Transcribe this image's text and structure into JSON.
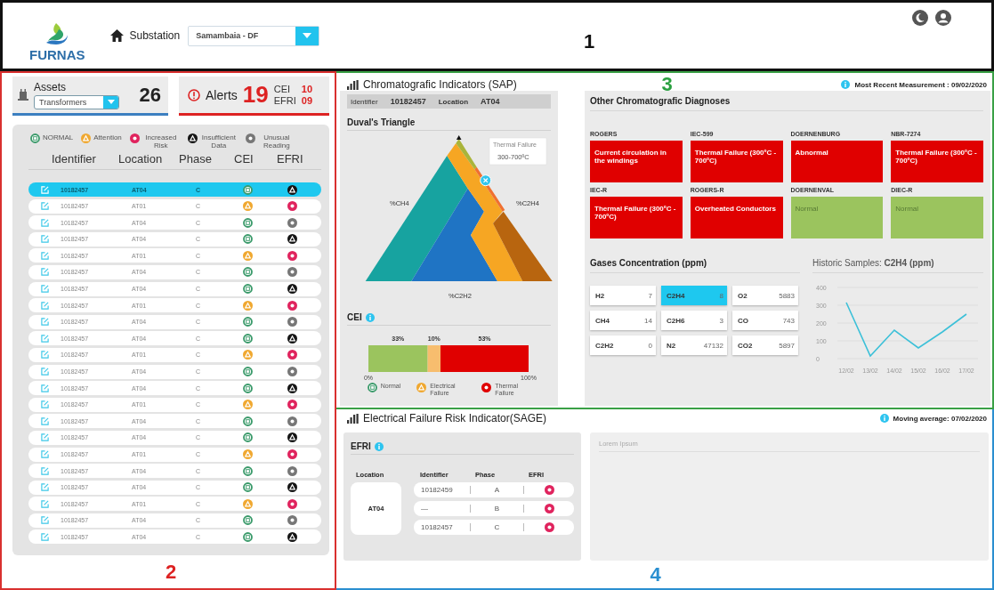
{
  "header": {
    "logo_text": "FURNAS",
    "substation_label": "Substation",
    "substation": "Samambaia - DF",
    "section_number": "1"
  },
  "assets": {
    "label": "Assets",
    "type": "Transformers",
    "count": "26"
  },
  "alerts": {
    "label": "Alerts",
    "count": "19",
    "items": [
      {
        "label": "CEI",
        "count": "10"
      },
      {
        "label": "EFRI",
        "count": "09"
      }
    ]
  },
  "legend": [
    {
      "label": "NORMAL",
      "kind": "normal"
    },
    {
      "label": "Attention",
      "kind": "attention"
    },
    {
      "label": "Increased Risk",
      "kind": "increased_risk"
    },
    {
      "label": "Insufficient Data",
      "kind": "insufficient_data"
    },
    {
      "label": "Unusual Reading",
      "kind": "unusual_reading"
    }
  ],
  "asset_table": {
    "columns": [
      "Identifier",
      "Location",
      "Phase",
      "CEI",
      "EFRI"
    ],
    "rows": [
      {
        "identifier": "10182457",
        "location": "AT04",
        "phase": "C",
        "cei": {
          "kind": "normal"
        },
        "efri": {
          "kind": "insufficient_data"
        },
        "selected": true
      },
      {
        "identifier": "10182457",
        "location": "AT01",
        "phase": "C",
        "cei": {
          "kind": "attention"
        },
        "efri": {
          "kind": "increased_risk"
        },
        "selected": false
      },
      {
        "identifier": "10182457",
        "location": "AT04",
        "phase": "C",
        "cei": {
          "kind": "normal"
        },
        "efri": {
          "kind": "unusual_reading"
        },
        "selected": false
      },
      {
        "identifier": "10182457",
        "location": "AT04",
        "phase": "C",
        "cei": {
          "kind": "normal"
        },
        "efri": {
          "kind": "insufficient_data"
        },
        "selected": false
      },
      {
        "identifier": "10182457",
        "location": "AT01",
        "phase": "C",
        "cei": {
          "kind": "attention"
        },
        "efri": {
          "kind": "increased_risk"
        },
        "selected": false
      },
      {
        "identifier": "10182457",
        "location": "AT04",
        "phase": "C",
        "cei": {
          "kind": "normal"
        },
        "efri": {
          "kind": "unusual_reading"
        },
        "selected": false
      },
      {
        "identifier": "10182457",
        "location": "AT04",
        "phase": "C",
        "cei": {
          "kind": "normal"
        },
        "efri": {
          "kind": "insufficient_data"
        },
        "selected": false
      },
      {
        "identifier": "10182457",
        "location": "AT01",
        "phase": "C",
        "cei": {
          "kind": "attention"
        },
        "efri": {
          "kind": "increased_risk"
        },
        "selected": false
      },
      {
        "identifier": "10182457",
        "location": "AT04",
        "phase": "C",
        "cei": {
          "kind": "normal"
        },
        "efri": {
          "kind": "unusual_reading"
        },
        "selected": false
      },
      {
        "identifier": "10182457",
        "location": "AT04",
        "phase": "C",
        "cei": {
          "kind": "normal"
        },
        "efri": {
          "kind": "insufficient_data"
        },
        "selected": false
      },
      {
        "identifier": "10182457",
        "location": "AT01",
        "phase": "C",
        "cei": {
          "kind": "attention"
        },
        "efri": {
          "kind": "increased_risk"
        },
        "selected": false
      },
      {
        "identifier": "10182457",
        "location": "AT04",
        "phase": "C",
        "cei": {
          "kind": "normal"
        },
        "efri": {
          "kind": "unusual_reading"
        },
        "selected": false
      },
      {
        "identifier": "10182457",
        "location": "AT04",
        "phase": "C",
        "cei": {
          "kind": "normal"
        },
        "efri": {
          "kind": "insufficient_data"
        },
        "selected": false
      },
      {
        "identifier": "10182457",
        "location": "AT01",
        "phase": "C",
        "cei": {
          "kind": "attention"
        },
        "efri": {
          "kind": "increased_risk"
        },
        "selected": false
      },
      {
        "identifier": "10182457",
        "location": "AT04",
        "phase": "C",
        "cei": {
          "kind": "normal"
        },
        "efri": {
          "kind": "unusual_reading"
        },
        "selected": false
      },
      {
        "identifier": "10182457",
        "location": "AT04",
        "phase": "C",
        "cei": {
          "kind": "normal"
        },
        "efri": {
          "kind": "insufficient_data"
        },
        "selected": false
      },
      {
        "identifier": "10182457",
        "location": "AT01",
        "phase": "C",
        "cei": {
          "kind": "attention"
        },
        "efri": {
          "kind": "increased_risk"
        },
        "selected": false
      },
      {
        "identifier": "10182457",
        "location": "AT04",
        "phase": "C",
        "cei": {
          "kind": "normal"
        },
        "efri": {
          "kind": "unusual_reading"
        },
        "selected": false
      },
      {
        "identifier": "10182457",
        "location": "AT04",
        "phase": "C",
        "cei": {
          "kind": "normal"
        },
        "efri": {
          "kind": "insufficient_data"
        },
        "selected": false
      },
      {
        "identifier": "10182457",
        "location": "AT01",
        "phase": "C",
        "cei": {
          "kind": "attention"
        },
        "efri": {
          "kind": "increased_risk"
        },
        "selected": false
      },
      {
        "identifier": "10182457",
        "location": "AT04",
        "phase": "C",
        "cei": {
          "kind": "normal"
        },
        "efri": {
          "kind": "unusual_reading"
        },
        "selected": false
      },
      {
        "identifier": "10182457",
        "location": "AT04",
        "phase": "C",
        "cei": {
          "kind": "normal"
        },
        "efri": {
          "kind": "insufficient_data"
        },
        "selected": false
      }
    ]
  },
  "left_section_number": "2",
  "chromatographic": {
    "title": "Chromatografic Indicators (SAP)",
    "section_number": "3",
    "measurement": "Most Recent Measurement : 09/02/2020",
    "identifier_label": "Identifier",
    "identifier": "10182457",
    "location_label": "Location",
    "location": "AT04",
    "duval": {
      "title": "Duval's Triangle",
      "tooltip_title": "Thermal Failure",
      "tooltip_value": "300-700ºC",
      "axis_labels": [
        "%CH4",
        "%C2H4",
        "%C2H2"
      ]
    },
    "cei": {
      "title": "CEI",
      "chart_data": {
        "type": "bar",
        "orientation": "horizontal",
        "stacked": true,
        "xlim": [
          0,
          1
        ],
        "xticks": [
          {
            "value": 0,
            "label": "0%"
          },
          {
            "value": 1,
            "label": "100%"
          }
        ],
        "value_labels": [
          "33%",
          "10%",
          "53%"
        ],
        "series": [
          {
            "color": "#9bc45e",
            "values": [
              0.37
            ]
          },
          {
            "color": "#f7bd6e",
            "values": [
              0.08
            ]
          },
          {
            "color": "#e00000",
            "values": [
              0.55
            ]
          }
        ]
      },
      "legend": [
        {
          "label": "Normal",
          "kind": "normal"
        },
        {
          "label": "Electrical Failure",
          "kind": "attention"
        },
        {
          "label": "Thermal Failure",
          "kind": "thermal"
        }
      ]
    },
    "diagnoses": {
      "title": "Other Chromatografic Diagnoses",
      "items": [
        {
          "method": "ROGERS",
          "result": "Current circulation in the windings",
          "kind": "alarm"
        },
        {
          "method": "IEC-599",
          "result": "Thermal Failure (300ºC - 700ºC)",
          "kind": "alarm"
        },
        {
          "method": "DOERNENBURG",
          "result": "Abnormal",
          "kind": "alarm"
        },
        {
          "method": "NBR-7274",
          "result": "Thermal Failure (300ºC - 700ºC)",
          "kind": "alarm"
        },
        {
          "method": "IEC-R",
          "result": "Thermal Failure (300ºC - 700ºC)",
          "kind": "alarm"
        },
        {
          "method": "ROGERS-R",
          "result": "Overheated Conductors",
          "kind": "alarm"
        },
        {
          "method": "DOERNENVAL",
          "result": "Normal",
          "kind": "normal"
        },
        {
          "method": "DIEC-R",
          "result": "Normal",
          "kind": "normal"
        }
      ]
    },
    "gases": {
      "title": "Gases Concentration (ppm)",
      "cells": [
        {
          "name": "H2",
          "value": "7",
          "selected": false
        },
        {
          "name": "C2H4",
          "value": "8",
          "selected": true
        },
        {
          "name": "O2",
          "value": "5883",
          "selected": false
        },
        {
          "name": "CH4",
          "value": "14",
          "selected": false
        },
        {
          "name": "C2H6",
          "value": "3",
          "selected": false
        },
        {
          "name": "CO",
          "value": "743",
          "selected": false
        },
        {
          "name": "C2H2",
          "value": "0",
          "selected": false
        },
        {
          "name": "N2",
          "value": "47132",
          "selected": false
        },
        {
          "name": "CO2",
          "value": "5897",
          "selected": false
        }
      ]
    },
    "historic": {
      "title": "Historic Samples: **C2H4 (ppm)**",
      "chart_data": {
        "type": "line",
        "grid": true,
        "x": [
          "12/02",
          "13/02",
          "14/02",
          "15/02",
          "16/02",
          "17/02"
        ],
        "ylim": [
          0,
          400
        ],
        "yticks": [
          0,
          100,
          200,
          300,
          400
        ],
        "series": [
          {
            "color": "#3cc0d8",
            "values": [
              315,
              15,
              160,
              60,
              150,
              250
            ]
          }
        ]
      }
    }
  },
  "electrical": {
    "title": "Electrical Failure Risk Indicator(SAGE)",
    "section_number": "4",
    "moving_average": "**Moving average:** 07/02/2020",
    "efri": {
      "title": "EFRI",
      "columns": [
        "Location",
        "Identifier",
        "Phase",
        "EFRI"
      ],
      "location": "AT04",
      "rows": [
        {
          "identifier": "10182459",
          "phase": "A",
          "efri": {
            "kind": "increased_risk"
          }
        },
        {
          "identifier": "—",
          "phase": "B",
          "efri": {
            "kind": "increased_risk"
          }
        },
        {
          "identifier": "10182457",
          "phase": "C",
          "efri": {
            "kind": "increased_risk"
          }
        }
      ]
    },
    "side_panel": {
      "title": "Lorem Ipsum"
    }
  }
}
